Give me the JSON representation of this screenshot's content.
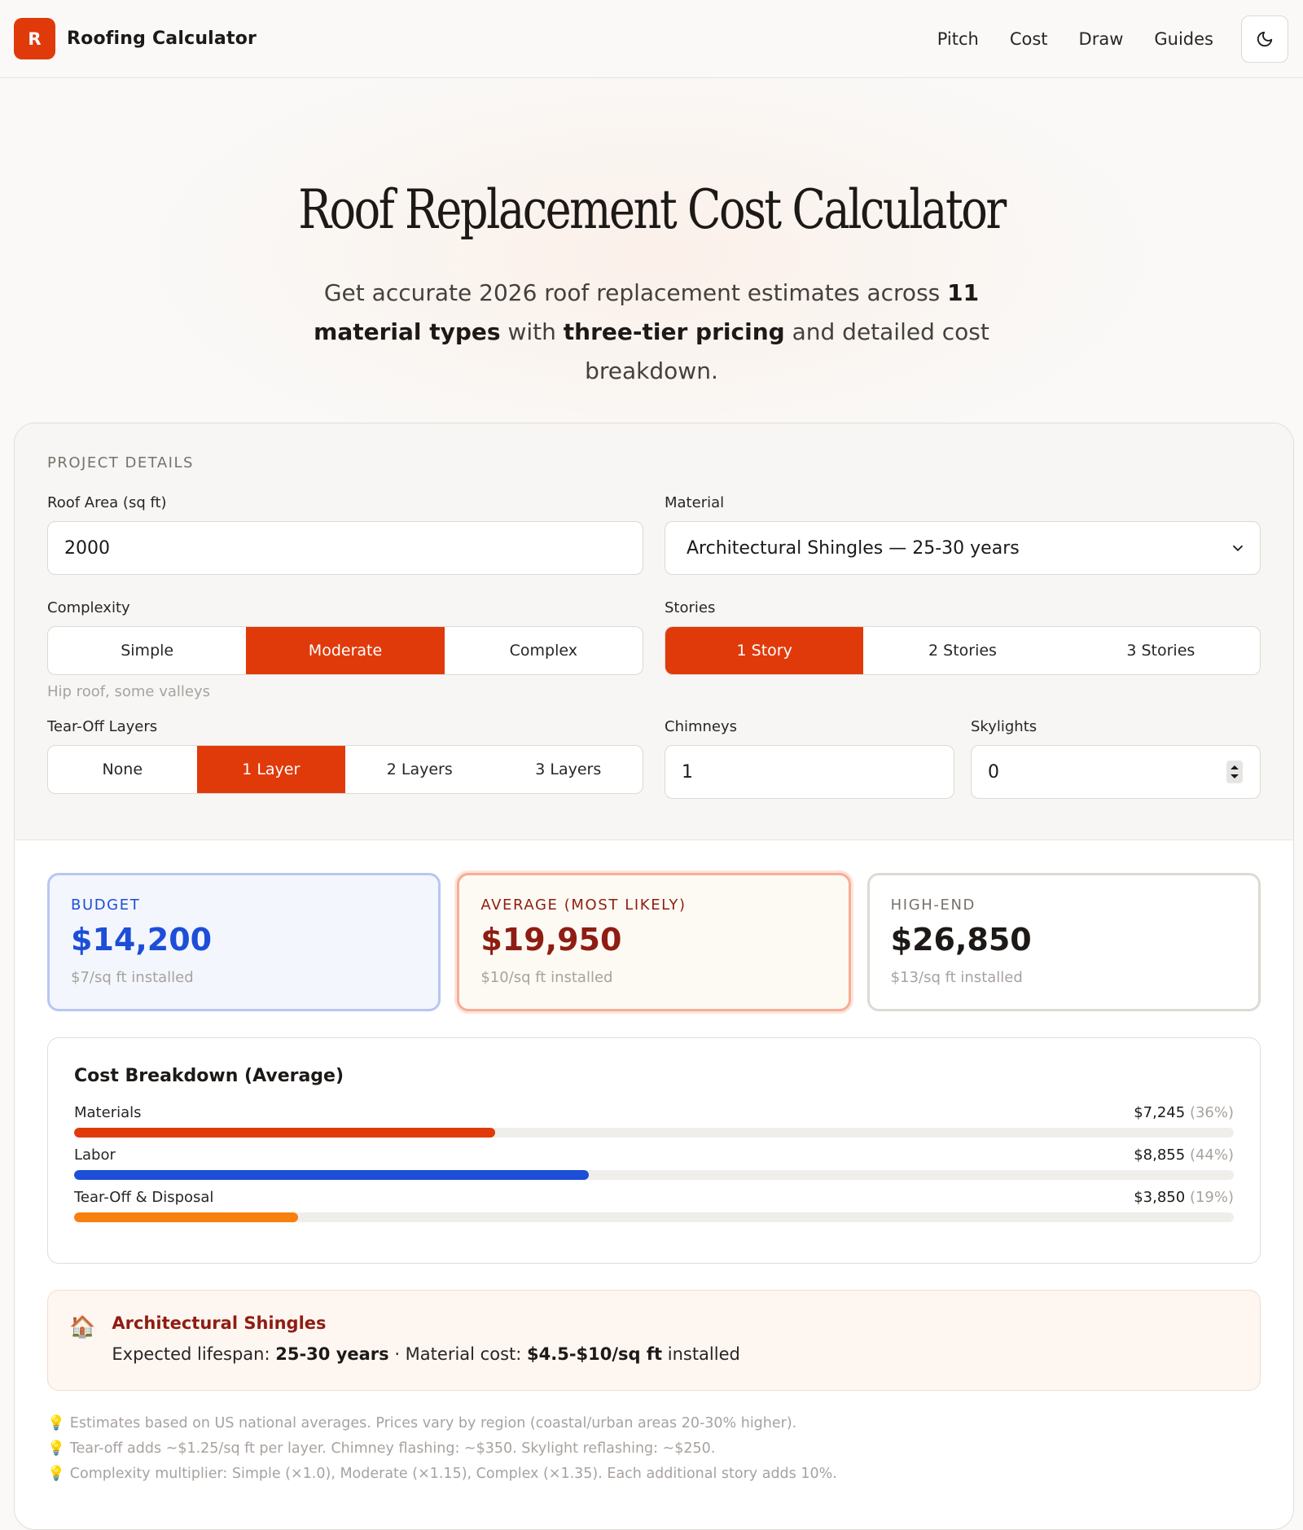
{
  "header": {
    "logo_letter": "R",
    "brand": "Roofing Calculator",
    "nav": [
      "Pitch",
      "Cost",
      "Draw",
      "Guides"
    ]
  },
  "hero": {
    "title": "Roof Replacement Cost Calculator",
    "subtitle_pre": "Get accurate 2026 roof replacement estimates across ",
    "subtitle_b1": "11 material types",
    "subtitle_mid": " with ",
    "subtitle_b2": "three-tier pricing",
    "subtitle_post": " and detailed cost breakdown."
  },
  "form": {
    "section": "PROJECT DETAILS",
    "area_label": "Roof Area (sq ft)",
    "area_value": "2000",
    "material_label": "Material",
    "material_value": "Architectural Shingles — 25-30 years",
    "complexity_label": "Complexity",
    "complexity_options": [
      "Simple",
      "Moderate",
      "Complex"
    ],
    "complexity_hint": "Hip roof, some valleys",
    "stories_label": "Stories",
    "stories_options": [
      "1 Story",
      "2 Stories",
      "3 Stories"
    ],
    "tearoff_label": "Tear-Off Layers",
    "tearoff_options": [
      "None",
      "1 Layer",
      "2 Layers",
      "3 Layers"
    ],
    "chimneys_label": "Chimneys",
    "chimneys_value": "1",
    "skylights_label": "Skylights",
    "skylights_value": "0"
  },
  "tiers": {
    "budget": {
      "label": "BUDGET",
      "price": "$14,200",
      "sub": "$7/sq ft installed"
    },
    "average": {
      "label": "AVERAGE (MOST LIKELY)",
      "price": "$19,950",
      "sub": "$10/sq ft installed"
    },
    "high": {
      "label": "HIGH-END",
      "price": "$26,850",
      "sub": "$13/sq ft installed"
    }
  },
  "breakdown": {
    "title": "Cost Breakdown (Average)",
    "items": [
      {
        "label": "Materials",
        "value": "$7,245",
        "pct": "(36%)",
        "fraction": 0.363
      },
      {
        "label": "Labor",
        "value": "$8,855",
        "pct": "(44%)",
        "fraction": 0.444
      },
      {
        "label": "Tear-Off & Disposal",
        "value": "$3,850",
        "pct": "(19%)",
        "fraction": 0.193
      }
    ],
    "colors": [
      "#e03a0b",
      "#1d4ed8",
      "#f97f0f"
    ]
  },
  "info": {
    "icon": "house-icon",
    "title": "Architectural Shingles",
    "lifespan_label": "Expected lifespan: ",
    "lifespan": "25-30 years",
    "sep": " · Material cost: ",
    "cost": "$4.5-$10/sq ft",
    "post": " installed"
  },
  "notes": [
    "Estimates based on US national averages. Prices vary by region (coastal/urban areas 20-30% higher).",
    "Tear-off adds ~$1.25/sq ft per layer. Chimney flashing: ~$350. Skylight reflashing: ~$250.",
    "Complexity multiplier: Simple (×1.0), Moderate (×1.15), Complex (×1.35). Each additional story adds 10%."
  ]
}
